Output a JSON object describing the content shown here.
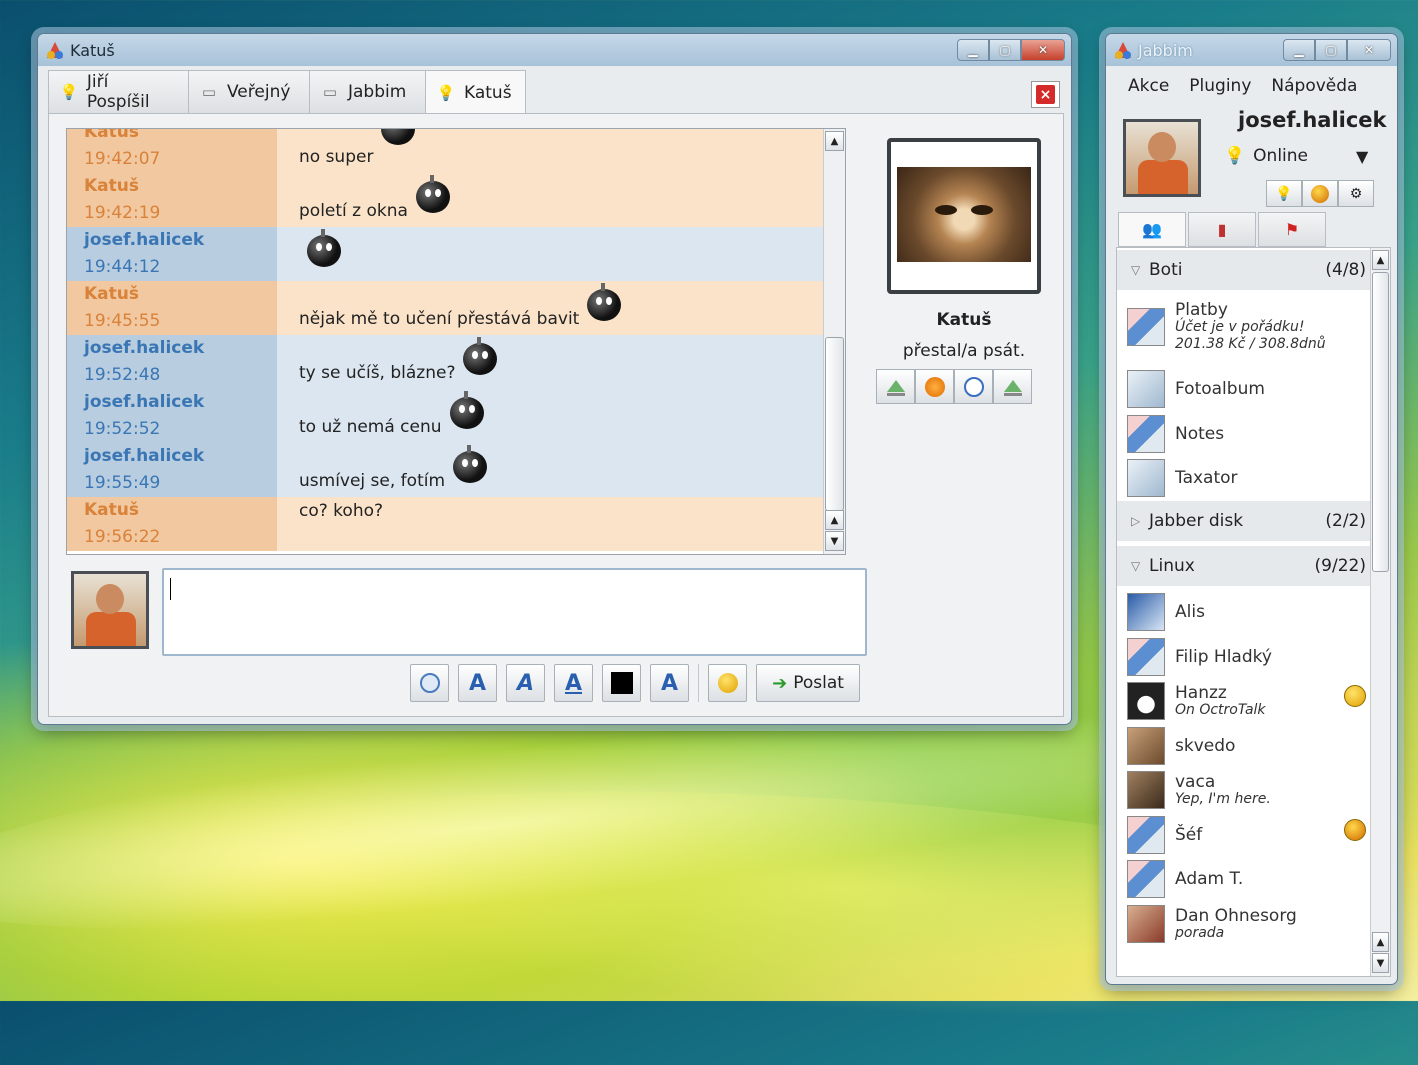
{
  "chat_window": {
    "title": "Katuš",
    "tabs": [
      {
        "label": "Jiří Pospíšil",
        "icon": "bulb-icon"
      },
      {
        "label": "Veřejný",
        "icon": "chat-icon"
      },
      {
        "label": "Jabbim",
        "icon": "chat-icon"
      },
      {
        "label": "Katuš",
        "icon": "bulb-icon"
      }
    ],
    "close_tab_label": "×",
    "messages": [
      {
        "nick": "Katuš",
        "time": "19:42:07",
        "text": "no super",
        "from": "them"
      },
      {
        "nick": "Katuš",
        "time": "19:42:19",
        "text": "poletí z okna",
        "from": "them"
      },
      {
        "nick": "josef.halicek",
        "time": "19:44:12",
        "text": "",
        "from": "me"
      },
      {
        "nick": "Katuš",
        "time": "19:45:55",
        "text": "nějak mě to učení přestává bavit",
        "from": "them"
      },
      {
        "nick": "josef.halicek",
        "time": "19:52:48",
        "text": "ty se učíš, blázne?",
        "from": "me"
      },
      {
        "nick": "josef.halicek",
        "time": "19:52:52",
        "text": "to už nemá cenu",
        "from": "me"
      },
      {
        "nick": "josef.halicek",
        "time": "19:55:49",
        "text": "usmívej se, fotím",
        "from": "me"
      },
      {
        "nick": "Katuš",
        "time": "19:56:22",
        "text": "co? koho?",
        "from": "them"
      }
    ],
    "contact": {
      "name": "Katuš",
      "status": "přestal/a psát."
    },
    "format_buttons": [
      "A",
      "A",
      "A",
      "A"
    ],
    "send_label": "Poslat",
    "input_value": ""
  },
  "roster_window": {
    "title": "Jabbim",
    "menu": [
      "Akce",
      "Pluginy",
      "Nápověda"
    ],
    "user": {
      "name": "josef.halicek",
      "status": "Online"
    },
    "groups": [
      {
        "name": "Boti",
        "count": "(4/8)",
        "expanded": true
      },
      {
        "name": "Jabber disk",
        "count": "(2/2)",
        "expanded": false
      },
      {
        "name": "Linux",
        "count": "(9/22)",
        "expanded": true
      }
    ],
    "bots": [
      {
        "name": "Platby",
        "sub1": "Účet je v pořádku!",
        "sub2": "201.38 Kč / 308.8dnů"
      },
      {
        "name": "Fotoalbum"
      },
      {
        "name": "Notes"
      },
      {
        "name": "Taxator"
      }
    ],
    "linux": [
      {
        "name": "Alis"
      },
      {
        "name": "Filip Hladký"
      },
      {
        "name": "Hanzz",
        "sub": "On OctroTalk"
      },
      {
        "name": "skvedo"
      },
      {
        "name": "vaca",
        "sub": "Yep, I'm here."
      },
      {
        "name": "Šéf"
      },
      {
        "name": "Adam T."
      },
      {
        "name": "Dan Ohnesorg",
        "sub": "porada"
      }
    ]
  },
  "colors": {
    "them_nick": "#d8823a",
    "me_nick": "#3a76b4",
    "them_bg": "#fbe3c9",
    "me_bg": "#dbe6f0"
  }
}
